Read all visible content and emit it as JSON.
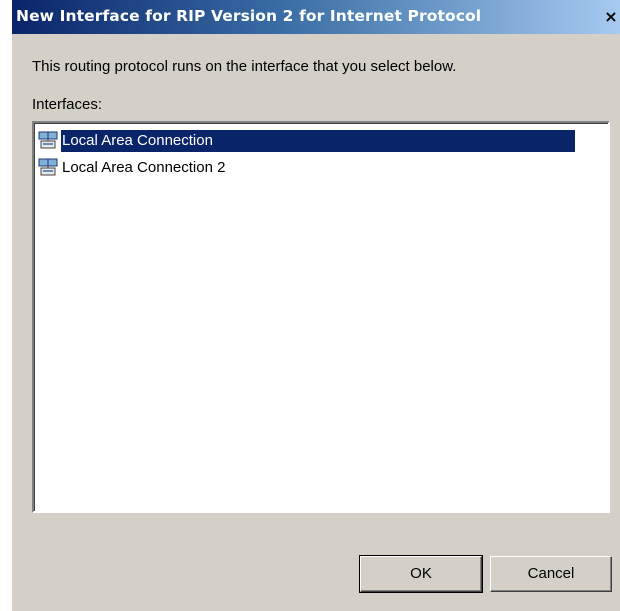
{
  "window": {
    "title": "New Interface for RIP Version 2 for Internet Protocol",
    "close_glyph": "×"
  },
  "description": "This routing protocol runs on the interface that you select below.",
  "interfaces": {
    "label": "Interfaces:",
    "items": [
      {
        "label": "Local Area Connection",
        "icon": "network-connection-icon",
        "selected": true
      },
      {
        "label": "Local Area Connection 2",
        "icon": "network-connection-icon",
        "selected": false
      }
    ]
  },
  "buttons": {
    "ok_label": "OK",
    "cancel_label": "Cancel"
  },
  "colors": {
    "title_bar_start": "#0a246a",
    "title_bar_end": "#a6caf0",
    "selection": "#0a246a",
    "dialog_face": "#d4d0c8"
  }
}
